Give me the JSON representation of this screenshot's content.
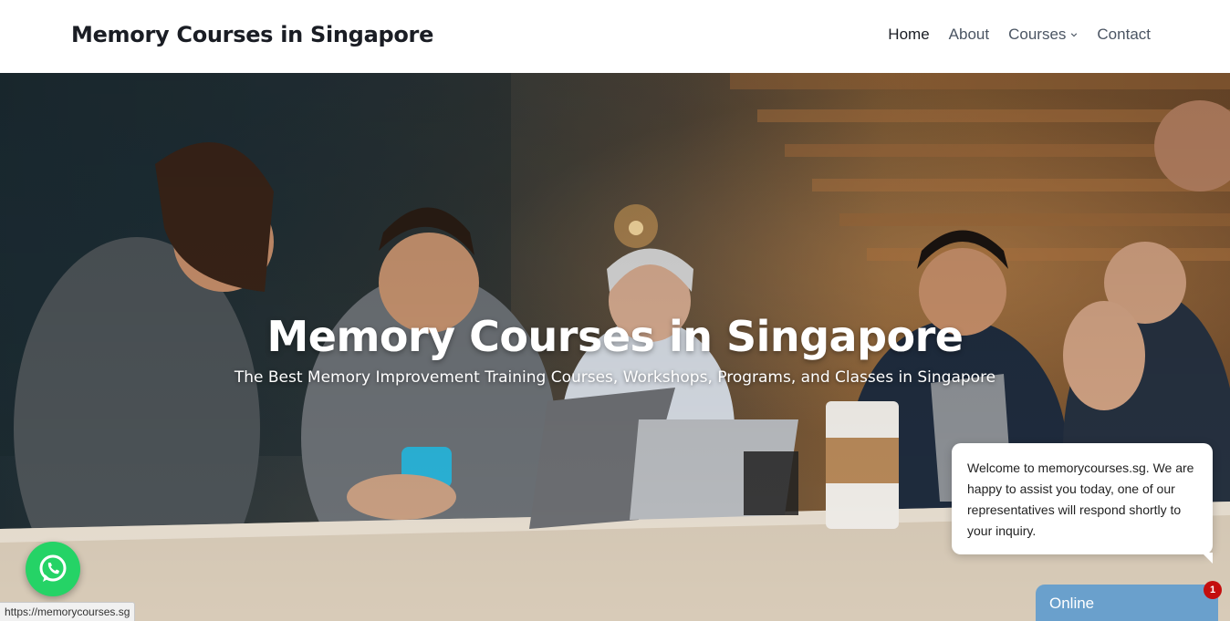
{
  "header": {
    "site_title": "Memory Courses in Singapore",
    "nav": [
      {
        "label": "Home",
        "active": true
      },
      {
        "label": "About",
        "active": false
      },
      {
        "label": "Courses",
        "active": false,
        "has_dropdown": true
      },
      {
        "label": "Contact",
        "active": false
      }
    ]
  },
  "hero": {
    "title": "Memory Courses in Singapore",
    "subtitle": "The Best Memory Improvement Training Courses, Workshops, Programs, and Classes in Singapore"
  },
  "chat": {
    "message": "Welcome to memorycourses.sg. We are happy to assist you today, one of our representatives will respond shortly to your inquiry.",
    "status_label": "Online",
    "unread_count": "1"
  },
  "status_bar": {
    "url": "https://memorycourses.sg"
  },
  "colors": {
    "whatsapp_green": "#25d366",
    "chat_tab_blue": "#6aa0cc",
    "badge_red": "#c40e0e",
    "title_dark": "#1a1d24"
  },
  "icons": {
    "whatsapp": "whatsapp-icon",
    "dropdown": "chevron-down-icon"
  }
}
